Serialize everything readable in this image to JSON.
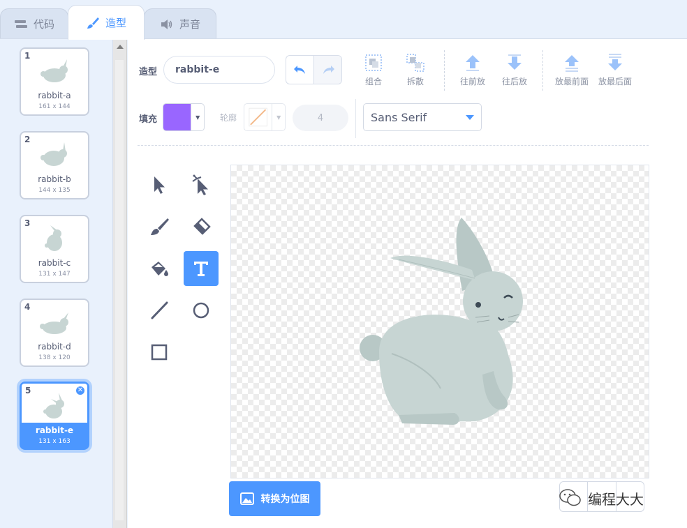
{
  "tabs": [
    {
      "label": "代码",
      "icon": "code-blocks-icon"
    },
    {
      "label": "造型",
      "icon": "paintbrush-icon"
    },
    {
      "label": "声音",
      "icon": "speaker-icon"
    }
  ],
  "costumes": [
    {
      "number": "1",
      "name": "rabbit-a",
      "size": "161 x 144"
    },
    {
      "number": "2",
      "name": "rabbit-b",
      "size": "144 x 135"
    },
    {
      "number": "3",
      "name": "rabbit-c",
      "size": "131 x 147"
    },
    {
      "number": "4",
      "name": "rabbit-d",
      "size": "138 x 120"
    },
    {
      "number": "5",
      "name": "rabbit-e",
      "size": "131 x 163",
      "selected": true
    }
  ],
  "editor": {
    "costume_label": "造型",
    "costume_name": "rabbit-e",
    "toolbar": {
      "group": "组合",
      "ungroup": "拆散",
      "forward": "往前放",
      "backward": "往后放",
      "front": "放最前面",
      "back": "放最后面"
    },
    "fill_label": "填充",
    "fill_color": "#9966ff",
    "outline_label": "轮廓",
    "stroke_width": "4",
    "font": "Sans Serif",
    "convert_button": "转换为位图",
    "active_tool": "text-tool"
  },
  "watermark": "编程大大",
  "colors": {
    "accent": "#4c97ff",
    "text": "#575e75",
    "rabbit": "#c7d5d3"
  }
}
